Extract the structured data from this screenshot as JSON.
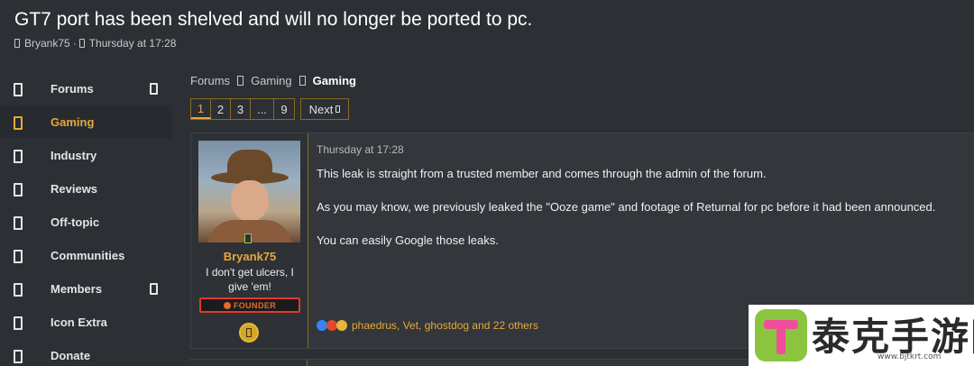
{
  "thread": {
    "title": "GT7 port has been shelved and will no longer be ported to pc.",
    "author": "Bryank75",
    "separator": "·",
    "date": "Thursday at 17:28"
  },
  "sidebar": {
    "items": [
      {
        "label": "Forums",
        "active": false,
        "has_trail": true
      },
      {
        "label": "Gaming",
        "active": true,
        "has_trail": false
      },
      {
        "label": "Industry",
        "active": false,
        "has_trail": false
      },
      {
        "label": "Reviews",
        "active": false,
        "has_trail": false
      },
      {
        "label": "Off-topic",
        "active": false,
        "has_trail": false
      },
      {
        "label": "Communities",
        "active": false,
        "has_trail": false
      },
      {
        "label": "Members",
        "active": false,
        "has_trail": true
      },
      {
        "label": "Icon Extra",
        "active": false,
        "has_trail": false
      },
      {
        "label": "Donate",
        "active": false,
        "has_trail": false
      }
    ]
  },
  "breadcrumb": [
    "Forums",
    "Gaming",
    "Gaming"
  ],
  "pagination": {
    "pages": [
      "1",
      "2",
      "3",
      "...",
      "9"
    ],
    "current": "1",
    "next_label": "Next"
  },
  "post": {
    "date": "Thursday at 17:28",
    "username": "Bryank75",
    "user_title": "I don't get ulcers, I give 'em!",
    "banner": "FOUNDER",
    "paragraphs": [
      "This leak is straight from a trusted member and comes through the admin of the forum.",
      "As you may know, we previously leaked the \"Ooze game\" and footage of Returnal for pc before it had been announced.",
      "You can easily Google those leaks."
    ],
    "reactions_text": "phaedrus, Vet, ghostdog and 22 others"
  },
  "watermark": {
    "text": "泰克手游网",
    "url": "www.bjtkrt.com"
  },
  "colors": {
    "accent": "#e8a83a",
    "background": "#2c2f34",
    "post_bg": "#33363b"
  }
}
